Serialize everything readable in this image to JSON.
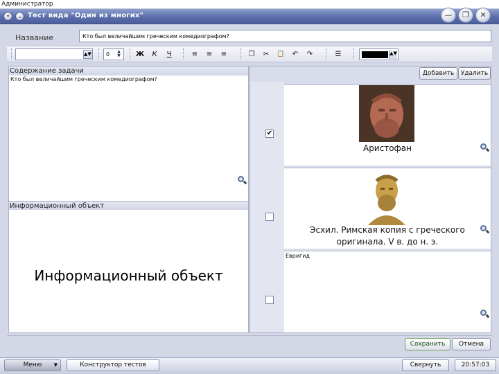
{
  "user": "Администратор",
  "window": {
    "title": "Тест вида \"Один из многих\"",
    "controls": {
      "minimize": "—",
      "restore": "❐",
      "close": "✕"
    }
  },
  "form": {
    "name_label": "Название",
    "name_value": "Кто был величайшим греческим комедиографом?"
  },
  "toolbar": {
    "font_size": "0",
    "tools": [
      {
        "name": "bold-button",
        "glyph": "Ж"
      },
      {
        "name": "italic-button",
        "glyph": "К"
      },
      {
        "name": "underline-button",
        "glyph": "Ч"
      },
      {
        "name": "align-left-button",
        "glyph": "≡"
      },
      {
        "name": "align-center-button",
        "glyph": "≡"
      },
      {
        "name": "align-right-button",
        "glyph": "≡"
      },
      {
        "name": "copy-button",
        "glyph": "❐"
      },
      {
        "name": "cut-button",
        "glyph": "✂"
      },
      {
        "name": "paste-button",
        "glyph": "📋"
      },
      {
        "name": "undo-button",
        "glyph": "↶"
      },
      {
        "name": "redo-button",
        "glyph": "↷"
      },
      {
        "name": "list-button",
        "glyph": "☰"
      }
    ],
    "text_color": "#000000"
  },
  "task": {
    "header": "Содержание задачи",
    "text": "Кто был величайшим греческим комедиографом?"
  },
  "info": {
    "header": "Информационный объект",
    "text": "Информационный объект"
  },
  "answers_panel": {
    "add_label": "Добавить",
    "delete_label": "Удалить",
    "answers": [
      {
        "checked": true,
        "caption": "Аристофан",
        "mark": "✔"
      },
      {
        "checked": false,
        "caption_line1": "Эсхил. Римская копия с греческого",
        "caption_line2": "оригинала. V в. до н. э."
      },
      {
        "checked": false,
        "text": "Евригид"
      }
    ]
  },
  "footer": {
    "save_label": "Сохранить",
    "cancel_label": "Отмена"
  },
  "taskbar": {
    "menu_label": "Меню",
    "constructor_label": "Конструктор тестов",
    "minimize_label": "Свернуть",
    "clock": "20:57:03"
  }
}
